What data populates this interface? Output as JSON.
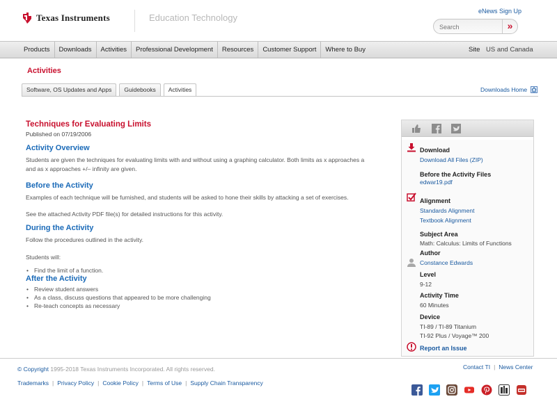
{
  "header": {
    "brand": "Texas Instruments",
    "subtitle": "Education Technology",
    "enews": "eNews Sign Up",
    "search_placeholder": "Search"
  },
  "nav": {
    "items": [
      "Products",
      "Downloads",
      "Activities",
      "Professional Development",
      "Resources",
      "Customer Support",
      "Where to Buy"
    ],
    "site_label": "Site",
    "site_value": "US and Canada"
  },
  "section_title": "Activities",
  "tabs": [
    "Software, OS Updates and Apps",
    "Guidebooks",
    "Activities"
  ],
  "downloads_home": "Downloads Home",
  "activity": {
    "title": "Techniques for Evaluating Limits",
    "published": "Published on 07/19/2006",
    "overview_h": "Activity Overview",
    "overview_p": "Students are given the techniques for evaluating limits with and without using a graphing calculator. Both limits as x approaches a and as x approaches +/– infinity are given.",
    "before_h": "Before the Activity",
    "before_p1": "Examples of each technique will be furnished, and students will be asked to hone their skills by attacking a set of exercises.",
    "before_p2": "See the attached Activity PDF file(s) for detailed instructions for this activity.",
    "during_h": "During the Activity",
    "during_p1": "Follow the procedures outlined in the activity.",
    "during_p2": "Students will:",
    "during_items": [
      "Find the limit of a function."
    ],
    "after_h": "After the Activity",
    "after_items": [
      "Review student answers",
      "As a class, discuss questions that appeared to be more challenging",
      "Re-teach concepts as necessary"
    ]
  },
  "sidebar": {
    "download_label": "Download",
    "download_all": "Download All Files (ZIP)",
    "before_files_label": "Before the Activity Files",
    "before_file": "edwar19.pdf",
    "alignment_label": "Alignment",
    "standards": "Standards Alignment",
    "textbook": "Textbook Alignment",
    "subject_label": "Subject Area",
    "subject_value": "Math: Calculus: Limits of Functions",
    "author_label": "Author",
    "author_value": "Constance Edwards",
    "level_label": "Level",
    "level_value": "9-12",
    "time_label": "Activity Time",
    "time_value": "60 Minutes",
    "device_label": "Device",
    "device_1": "TI-89 / TI-89 Titanium",
    "device_2": "TI-92 Plus / Voyage™ 200",
    "report": "Report an Issue"
  },
  "footer": {
    "copyright_symbol": "© Copyright",
    "copyright_text": " 1995-2018 Texas Instruments Incorporated. All rights reserved.",
    "links": [
      "Trademarks",
      "Privacy Policy",
      "Cookie Policy",
      "Terms of Use",
      "Supply Chain Transparency"
    ],
    "contact": "Contact TI",
    "news": "News Center"
  },
  "icons": [
    "thumbs-up-icon",
    "facebook-icon",
    "twitter-icon",
    "download-icon",
    "checkbox-icon",
    "author-icon",
    "report-icon",
    "facebook-icon",
    "twitter-icon",
    "instagram-icon",
    "youtube-icon",
    "pinterest-icon",
    "ti-blog-icon",
    "tube-icon"
  ],
  "colors": {
    "brand_red": "#c8102e",
    "link_blue": "#1a5aa0",
    "heading_blue": "#1a6ab8"
  }
}
